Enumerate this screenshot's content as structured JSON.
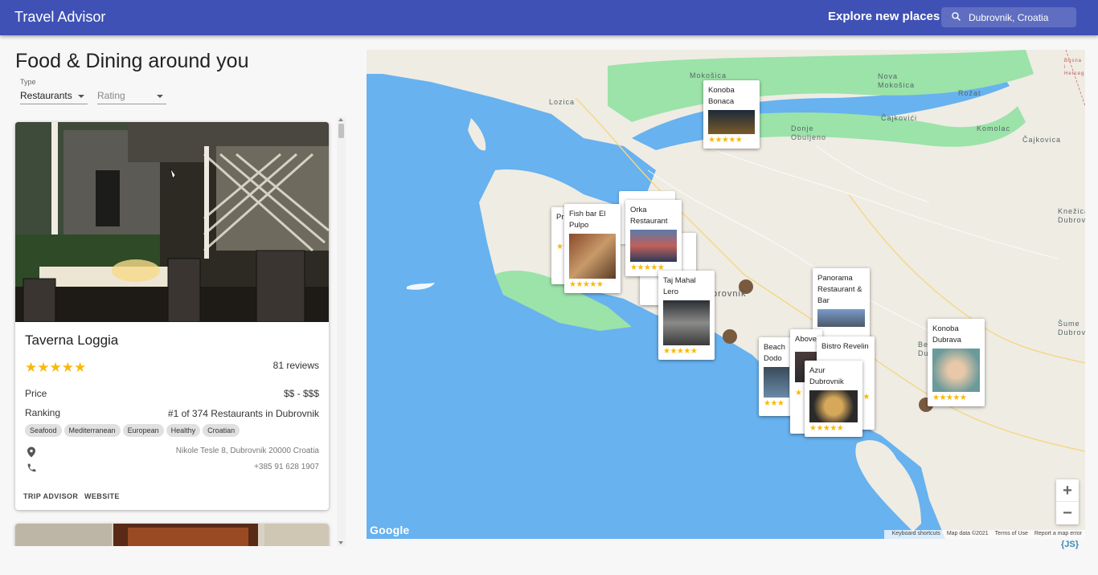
{
  "header": {
    "title": "Travel Advisor",
    "explore_label": "Explore new places",
    "search_value": "Dubrovnik, Croatia"
  },
  "sidebar": {
    "title": "Food & Dining around you",
    "type_label": "Type",
    "type_value": "Restaurants",
    "rating_value": "Rating"
  },
  "card": {
    "name": "Taverna Loggia",
    "rating": 5,
    "stars": "★★★★★",
    "reviews": "81 reviews",
    "price_label": "Price",
    "price_value": "$$ - $$$",
    "ranking_label": "Ranking",
    "ranking_value": "#1 of 374 Restaurants in Dubrovnik",
    "cuisines": [
      "Seafood",
      "Mediterranean",
      "European",
      "Healthy",
      "Croatian"
    ],
    "address": "Nikole Tesle 8, Dubrovnik 20000 Croatia",
    "phone": "+385 91 628 1907",
    "trip_advisor_label": "TRIP ADVISOR",
    "website_label": "WEBSITE",
    "icons": [
      "location-icon",
      "phone-icon"
    ]
  },
  "map": {
    "places": [
      "Mokošica",
      "Nova Mokošica",
      "Rožat",
      "Lozica",
      "Čajkovići",
      "Komolac",
      "Čajkovica",
      "Donje Obuljeno",
      "Knežica Dubrova",
      "Šume Dubrova",
      "brovnik",
      "Be Du",
      "Bosna i Hercegovina"
    ],
    "markers": [
      {
        "name": "Konoba Bonaca",
        "stars": "★★★★★"
      },
      {
        "name": "Pr Bi",
        "stars": "★★"
      },
      {
        "name": "Fish bar El Pulpo",
        "stars": "★★★★★"
      },
      {
        "name": "Orka Restaurant",
        "stars": "★★★★★"
      },
      {
        "name": "Taj Mahal Lero",
        "stars": "★★★★★"
      },
      {
        "name": "Panorama Restaurant & Bar",
        "stars": ""
      },
      {
        "name": "Beach Dodo",
        "stars": "★★★"
      },
      {
        "name": "Above Roofto Re",
        "stars": "★"
      },
      {
        "name": "Bistro Revelin",
        "stars": "★"
      },
      {
        "name": "Azur Dubrovnik",
        "stars": "★★★★★"
      },
      {
        "name": "Konoba Dubrava",
        "stars": "★★★★★"
      }
    ],
    "zoom_in": "+",
    "zoom_out": "−",
    "google": "Google",
    "attribution": [
      "Keyboard shortcuts",
      "Map data ©2021",
      "Terms of Use",
      "Report a map error"
    ]
  },
  "badge": "{JS}",
  "colors": {
    "appbar": "#3f51b5",
    "star": "#f9b908",
    "water": "#67b2ef",
    "park": "#9be3a8",
    "land": "#efece4"
  }
}
